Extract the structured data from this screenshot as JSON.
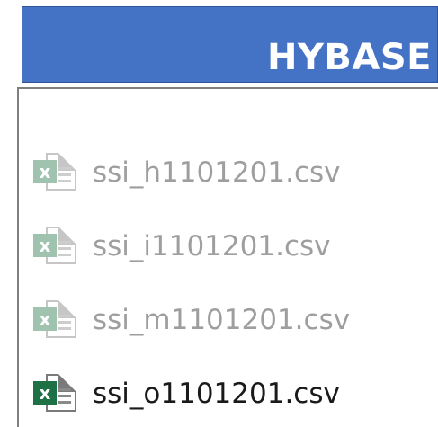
{
  "header": {
    "title": "HYBASE",
    "color": "#4472C4"
  },
  "files": [
    {
      "name": "ssi_h1101201.csv",
      "icon": "excel-csv-icon",
      "state": "dimmed"
    },
    {
      "name": "ssi_i1101201.csv",
      "icon": "excel-csv-icon",
      "state": "dimmed"
    },
    {
      "name": "ssi_m1101201.csv",
      "icon": "excel-csv-icon",
      "state": "dimmed"
    },
    {
      "name": "ssi_o1101201.csv",
      "icon": "excel-csv-icon",
      "state": "normal"
    }
  ],
  "excel_badge_letter": "x",
  "excel_color": "#1E7145"
}
